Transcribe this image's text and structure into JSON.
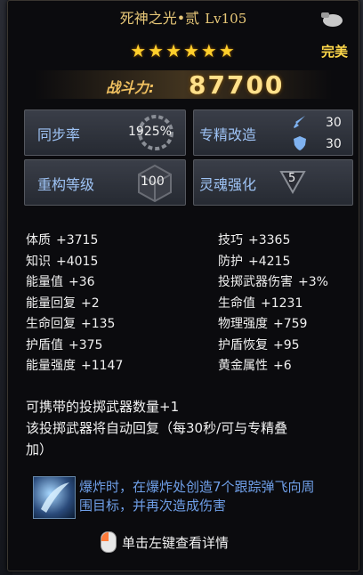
{
  "item": {
    "name": "死神之光•贰",
    "level": "Lv105",
    "stars": "★★★★★★",
    "quality": "完美",
    "power_label": "战斗力:",
    "power_value": "87700"
  },
  "attributes": {
    "sync_label": "同步率",
    "sync_value": "1925%",
    "refine_label": "专精改造",
    "refine_attack": "30",
    "refine_defense": "30",
    "rebuild_label": "重构等级",
    "rebuild_value": "100",
    "soul_label": "灵魂强化",
    "soul_value": "5"
  },
  "stats_left": [
    {
      "name": "体质",
      "value": "+3715"
    },
    {
      "name": "知识",
      "value": "+4015"
    },
    {
      "name": "能量值",
      "value": "+36"
    },
    {
      "name": "能量回复",
      "value": "+2"
    },
    {
      "name": "生命回复",
      "value": "+135"
    },
    {
      "name": "护盾值",
      "value": "+375"
    },
    {
      "name": "能量强度",
      "value": "+1147"
    }
  ],
  "stats_right": [
    {
      "name": "技巧",
      "value": "+3365"
    },
    {
      "name": "防护",
      "value": "+4215"
    },
    {
      "name": "投掷武器伤害",
      "value": "+3%"
    },
    {
      "name": "生命值",
      "value": "+1231"
    },
    {
      "name": "物理强度",
      "value": "+759"
    },
    {
      "name": "护盾恢复",
      "value": "+95"
    },
    {
      "name": "黄金属性",
      "value": "+6"
    }
  ],
  "description": {
    "line1": "可携带的投掷武器数量+1",
    "line2": "该投掷武器将自动回复（每30秒/可与专精叠",
    "line3": "加）"
  },
  "skill": {
    "line1": "爆炸时，在爆炸处创造7个跟踪弹飞向周",
    "line2": "围目标，并再次造成伤害"
  },
  "hint": "单击左键查看详情",
  "colors": {
    "title": "#e8c878",
    "stars": "#ffcf2c",
    "label_blue": "#9ec3f5",
    "skill_text": "#6f9fe8"
  },
  "icons": [
    "grenade-icon",
    "sword-icon",
    "shield-icon",
    "cube-icon",
    "soul-triangle-icon",
    "skill-icon",
    "mouse-icon"
  ]
}
